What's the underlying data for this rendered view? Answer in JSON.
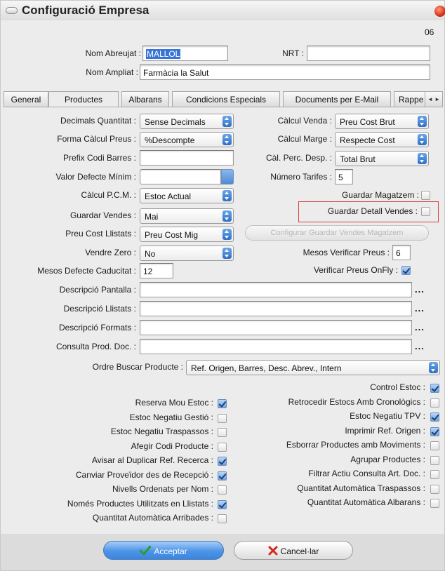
{
  "window": {
    "title": "Configuració Empresa",
    "code": "06"
  },
  "header": {
    "nom_abreujat_label": "Nom Abreujat :",
    "nom_abreujat_value": "MALLOL",
    "nrt_label": "NRT :",
    "nrt_value": "",
    "nom_ampliat_label": "Nom Ampliat :",
    "nom_ampliat_value": "Farmàcia la Salut"
  },
  "tabs": [
    {
      "label": "General"
    },
    {
      "label": "Productes"
    },
    {
      "label": "Albarans"
    },
    {
      "label": "Condicions Especials"
    },
    {
      "label": "Documents per E-Mail"
    },
    {
      "label": "Rappe"
    }
  ],
  "tab_scroll": "◄ ►",
  "active_tab": "Productes",
  "left": {
    "decimals_quantitat_label": "Decimals Quantitat :",
    "decimals_quantitat_value": "Sense Decimals",
    "forma_calcul_preus_label": "Forma Càlcul Preus :",
    "forma_calcul_preus_value": "%Descompte",
    "prefix_codi_barres_label": "Prefix Codi Barres :",
    "prefix_codi_barres_value": "",
    "valor_defecte_minim_label": "Valor Defecte Mínim :",
    "valor_defecte_minim_value": "",
    "calcul_pcm_label": "Càlcul P.C.M. :",
    "calcul_pcm_value": "Estoc Actual",
    "guardar_vendes_label": "Guardar Vendes :",
    "guardar_vendes_value": "Mai",
    "preu_cost_llistats_label": "Preu Cost Llistats :",
    "preu_cost_llistats_value": "Preu Cost Mig",
    "vendre_zero_label": "Vendre Zero :",
    "vendre_zero_value": "No",
    "mesos_defecte_caducitat_label": "Mesos Defecte Caducitat :",
    "mesos_defecte_caducitat_value": "12"
  },
  "right": {
    "calcul_venda_label": "Càlcul Venda :",
    "calcul_venda_value": "Preu Cost Brut",
    "calcul_marge_label": "Càlcul Marge :",
    "calcul_marge_value": "Respecte Cost",
    "cal_perc_desp_label": "Càl. Perc. Desp. :",
    "cal_perc_desp_value": "Total Brut",
    "numero_tarifes_label": "Número Tarifes :",
    "numero_tarifes_value": "5",
    "guardar_magatzem_label": "Guardar Magatzem :",
    "guardar_detall_vendes_label": "Guardar Detall Vendes :",
    "configurar_btn": "Configurar Guardar Vendes Magatzem",
    "mesos_verificar_preus_label": "Mesos Verificar Preus :",
    "mesos_verificar_preus_value": "6",
    "verificar_preus_onfly_label": "Verificar Preus OnFly :"
  },
  "descriptions": {
    "descripcio_pantalla_label": "Descripció Pantalla :",
    "descripcio_llistats_label": "Descripció Llistats :",
    "descripcio_formats_label": "Descripció Formats :",
    "consulta_prod_doc_label": "Consulta Prod. Doc. :",
    "ellipsis": "..."
  },
  "ordre": {
    "label": "Ordre Buscar Producte :",
    "value": "Ref. Origen, Barres, Desc. Abrev., Intern"
  },
  "options_left": [
    {
      "label": "Reserva Mou Estoc :",
      "checked": true
    },
    {
      "label": "Estoc Negatiu Gestió :",
      "checked": false
    },
    {
      "label": "Estoc Negatiu Traspassos :",
      "checked": false
    },
    {
      "label": "Afegir Codi Producte :",
      "checked": false
    },
    {
      "label": "Avisar al Duplicar Ref. Recerca :",
      "checked": true
    },
    {
      "label": "Canviar Proveïdor des de Recepció :",
      "checked": true
    },
    {
      "label": "Nivells Ordenats per Nom :",
      "checked": false
    },
    {
      "label": "Només Productes Utilitzats en Llistats :",
      "checked": true
    },
    {
      "label": "Quantitat Automàtica Arribades :",
      "checked": false
    }
  ],
  "options_right": [
    {
      "label": "Control Estoc :",
      "checked": true
    },
    {
      "label": "Retrocedir Estocs Amb Cronològics :",
      "checked": false
    },
    {
      "label": "Estoc Negatiu TPV :",
      "checked": true
    },
    {
      "label": "Imprimir Ref. Origen :",
      "checked": true
    },
    {
      "label": "Esborrar Productes amb Moviments :",
      "checked": false
    },
    {
      "label": "Agrupar Productes :",
      "checked": false
    },
    {
      "label": "Filtrar Actiu Consulta Art. Doc. :",
      "checked": false
    },
    {
      "label": "Quantitat Automàtica Traspassos :",
      "checked": false
    },
    {
      "label": "Quantitat Automàtica Albarans :",
      "checked": false
    }
  ],
  "buttons": {
    "accept": "Acceptar",
    "cancel": "Cancel·lar"
  },
  "colors": {
    "accent": "#3a86e0",
    "highlight": "#d6413a",
    "check_green": "#2e9b2e",
    "cancel_red": "#d22a1d"
  }
}
